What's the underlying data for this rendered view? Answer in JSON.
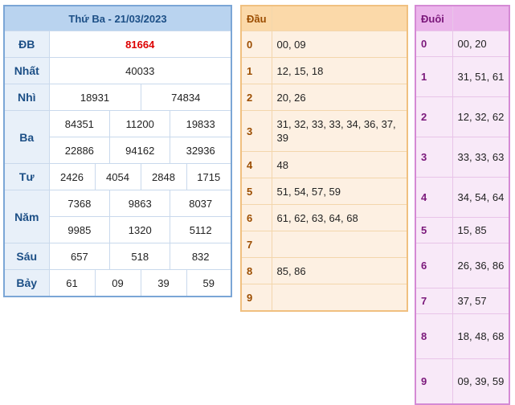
{
  "results": {
    "title": "Thứ Ba - 21/03/2023",
    "rows": [
      {
        "label": "ĐB",
        "values": [
          "81664"
        ]
      },
      {
        "label": "Nhất",
        "values": [
          "40033"
        ]
      },
      {
        "label": "Nhì",
        "values": [
          "18931",
          "74834"
        ]
      },
      {
        "label": "Ba",
        "values": [
          "84351",
          "11200",
          "19833",
          "22886",
          "94162",
          "32936"
        ]
      },
      {
        "label": "Tư",
        "values": [
          "2426",
          "4054",
          "2848",
          "1715"
        ]
      },
      {
        "label": "Năm",
        "values": [
          "7368",
          "9863",
          "8037",
          "9985",
          "1320",
          "5112"
        ]
      },
      {
        "label": "Sáu",
        "values": [
          "657",
          "518",
          "832"
        ]
      },
      {
        "label": "Bảy",
        "values": [
          "61",
          "09",
          "39",
          "59"
        ]
      }
    ]
  },
  "dau": {
    "header": "Đầu",
    "header_value": "",
    "rows": [
      {
        "key": "0",
        "value": "00, 09"
      },
      {
        "key": "1",
        "value": "12, 15, 18"
      },
      {
        "key": "2",
        "value": "20, 26"
      },
      {
        "key": "3",
        "value": "31, 32, 33, 33, 34, 36, 37, 39"
      },
      {
        "key": "4",
        "value": "48"
      },
      {
        "key": "5",
        "value": "51, 54, 57, 59"
      },
      {
        "key": "6",
        "value": "61, 62, 63, 64, 68"
      },
      {
        "key": "7",
        "value": ""
      },
      {
        "key": "8",
        "value": "85, 86"
      },
      {
        "key": "9",
        "value": ""
      }
    ]
  },
  "duoi": {
    "header": "Đuôi",
    "header_value": "",
    "rows": [
      {
        "key": "0",
        "value": "00, 20"
      },
      {
        "key": "1",
        "value": "31, 51, 61"
      },
      {
        "key": "2",
        "value": "12, 32, 62"
      },
      {
        "key": "3",
        "value": "33, 33, 63"
      },
      {
        "key": "4",
        "value": "34, 54, 64"
      },
      {
        "key": "5",
        "value": "15, 85"
      },
      {
        "key": "6",
        "value": "26, 36, 86"
      },
      {
        "key": "7",
        "value": "37, 57"
      },
      {
        "key": "8",
        "value": "18, 48, 68"
      },
      {
        "key": "9",
        "value": "09, 39, 59"
      }
    ]
  },
  "colors": {
    "special_prize": "#dd0000",
    "results_header": "#b9d3ef",
    "dau_header": "#fbd9a9",
    "duoi_header": "#ebb4eb"
  }
}
